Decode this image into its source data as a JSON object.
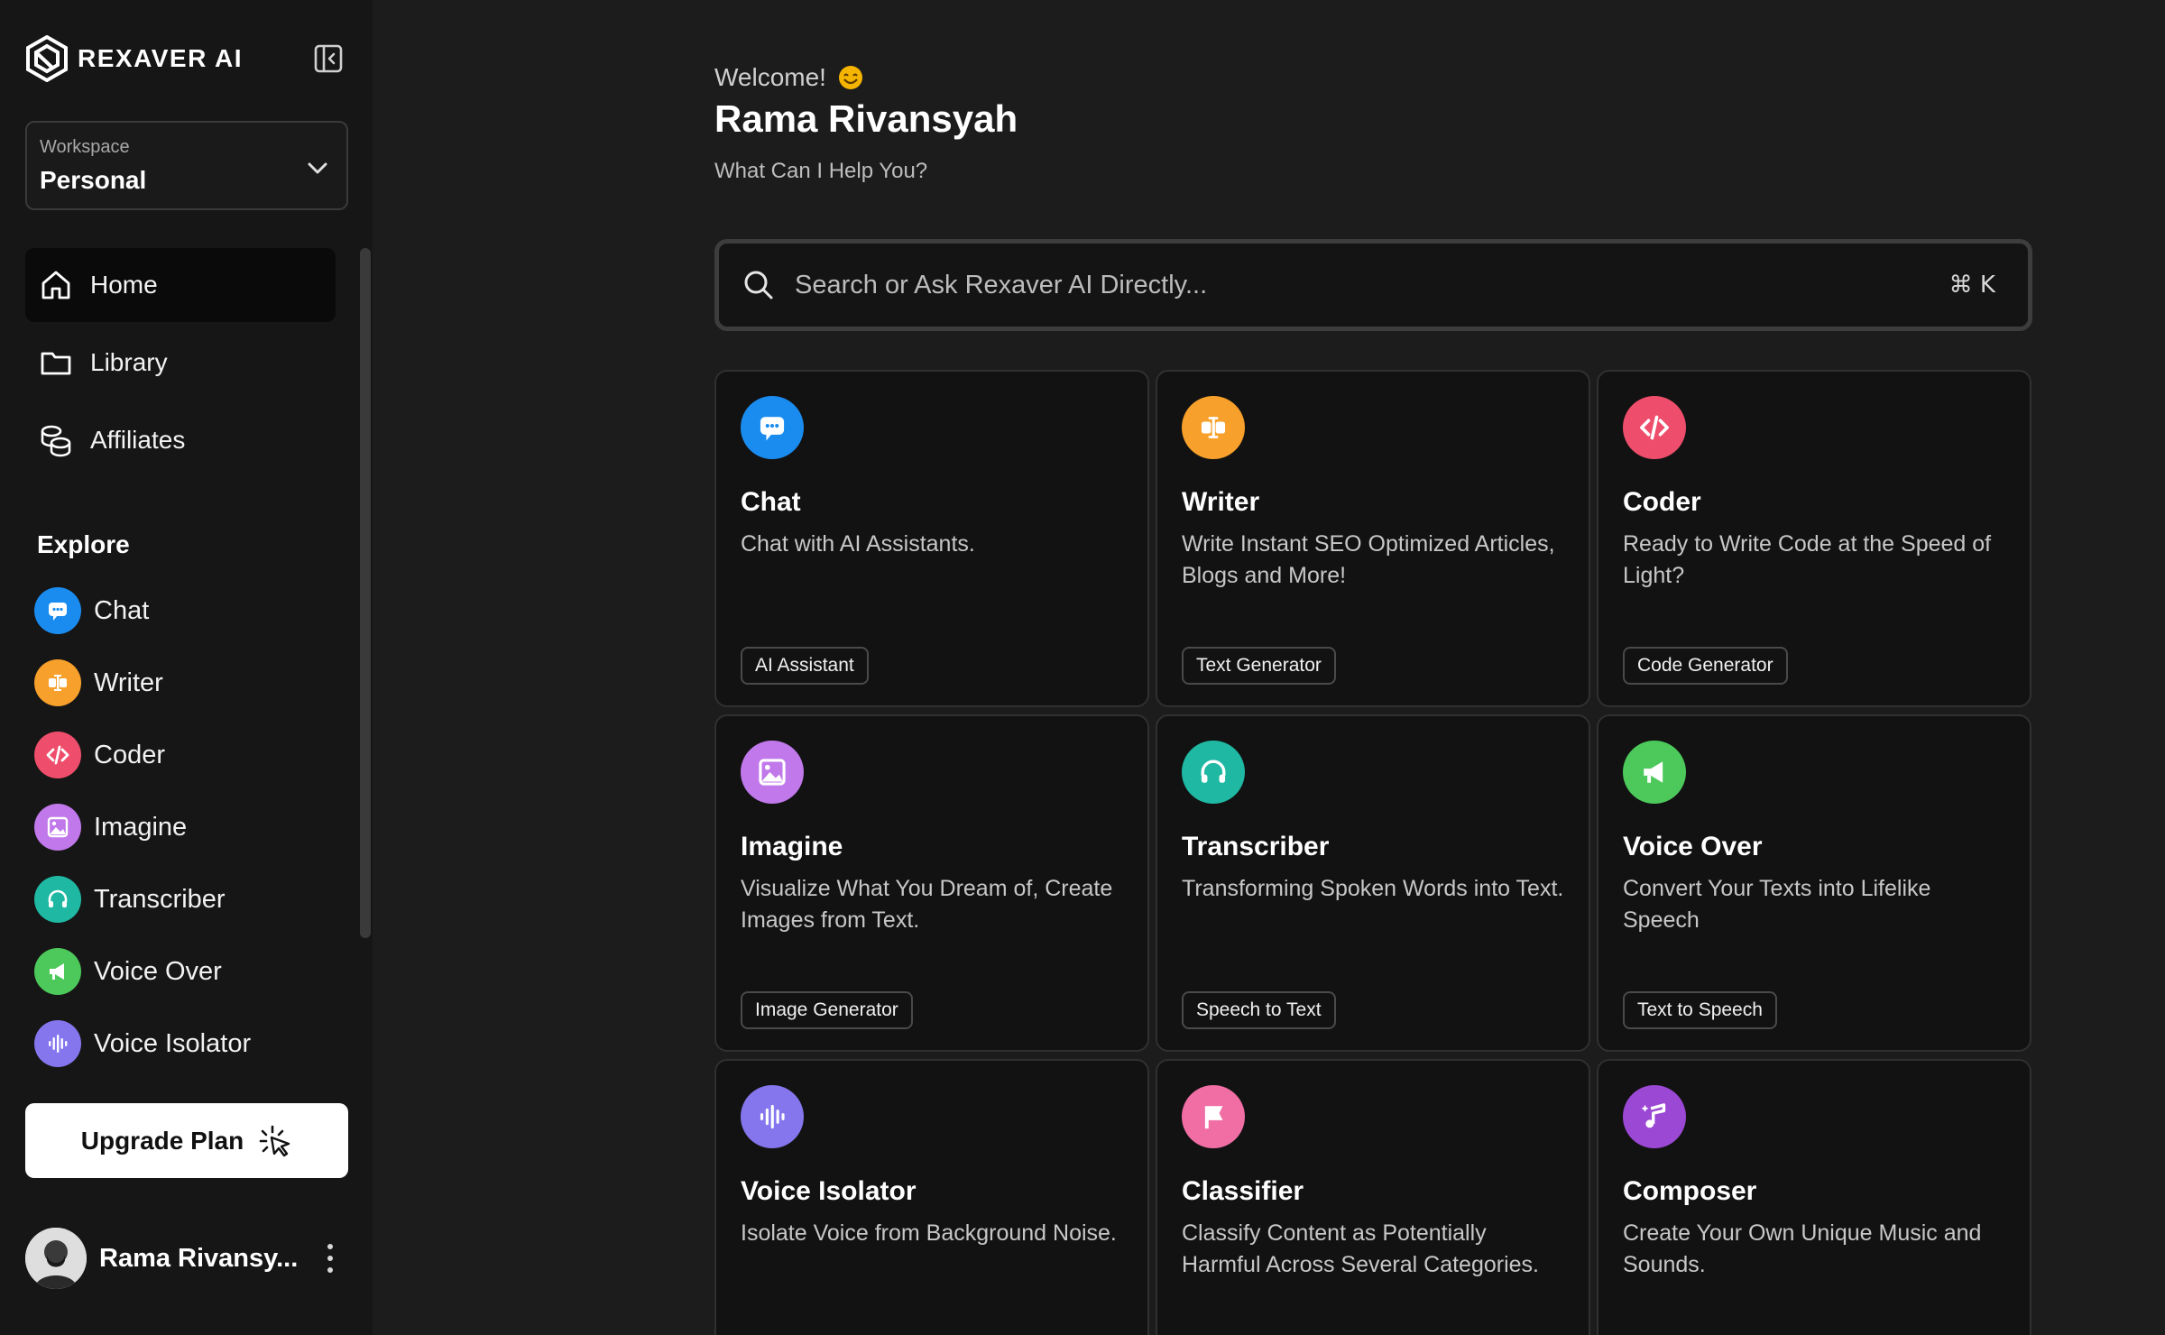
{
  "brand": {
    "name": "REXAVER AI"
  },
  "workspace": {
    "label": "Workspace",
    "value": "Personal"
  },
  "nav": [
    {
      "label": "Home",
      "icon": "home-icon",
      "active": true
    },
    {
      "label": "Library",
      "icon": "folder-icon"
    },
    {
      "label": "Affiliates",
      "icon": "coins-icon"
    }
  ],
  "explore": {
    "title": "Explore",
    "items": [
      {
        "label": "Chat",
        "icon": "chat-icon",
        "color": "#1a8cf0"
      },
      {
        "label": "Writer",
        "icon": "writer-icon",
        "color": "#f7a02b"
      },
      {
        "label": "Coder",
        "icon": "code-icon",
        "color": "#ee4e6b"
      },
      {
        "label": "Imagine",
        "icon": "image-icon",
        "color": "#c078ea"
      },
      {
        "label": "Transcriber",
        "icon": "headphones-icon",
        "color": "#1fb8a3"
      },
      {
        "label": "Voice Over",
        "icon": "megaphone-icon",
        "color": "#4cc95a"
      },
      {
        "label": "Voice Isolator",
        "icon": "waveform-icon",
        "color": "#8576ee"
      }
    ]
  },
  "upgrade": {
    "label": "Upgrade Plan"
  },
  "user": {
    "name": "Rama Rivansy..."
  },
  "main": {
    "welcome": "Welcome!",
    "user_name": "Rama Rivansyah",
    "subtitle": "What Can I Help You?",
    "search": {
      "placeholder": "Search or Ask Rexaver AI Directly...",
      "shortcut": "⌘ K"
    }
  },
  "cards": [
    {
      "title": "Chat",
      "desc": "Chat with AI Assistants.",
      "tag": "AI Assistant",
      "icon": "chat-icon",
      "color": "#1a8cf0"
    },
    {
      "title": "Writer",
      "desc": "Write Instant SEO Optimized Articles, Blogs and More!",
      "tag": "Text Generator",
      "icon": "writer-icon",
      "color": "#f7a02b"
    },
    {
      "title": "Coder",
      "desc": "Ready to Write Code at the Speed of Light?",
      "tag": "Code Generator",
      "icon": "code-icon",
      "color": "#ee4e6b"
    },
    {
      "title": "Imagine",
      "desc": "Visualize What You Dream of, Create Images from Text.",
      "tag": "Image Generator",
      "icon": "image-icon",
      "color": "#c078ea"
    },
    {
      "title": "Transcriber",
      "desc": "Transforming Spoken Words into Text.",
      "tag": "Speech to Text",
      "icon": "headphones-icon",
      "color": "#1fb8a3"
    },
    {
      "title": "Voice Over",
      "desc": "Convert Your Texts into Lifelike Speech",
      "tag": "Text to Speech",
      "icon": "megaphone-icon",
      "color": "#4cc95a"
    },
    {
      "title": "Voice Isolator",
      "desc": "Isolate Voice from Background Noise.",
      "tag": "",
      "icon": "waveform-icon",
      "color": "#8576ee"
    },
    {
      "title": "Classifier",
      "desc": "Classify Content as Potentially Harmful Across Several Categories.",
      "tag": "",
      "icon": "flag-icon",
      "color": "#f06ea4"
    },
    {
      "title": "Composer",
      "desc": "Create Your Own Unique Music and Sounds.",
      "tag": "",
      "icon": "music-icon",
      "color": "#9b48d4"
    }
  ]
}
